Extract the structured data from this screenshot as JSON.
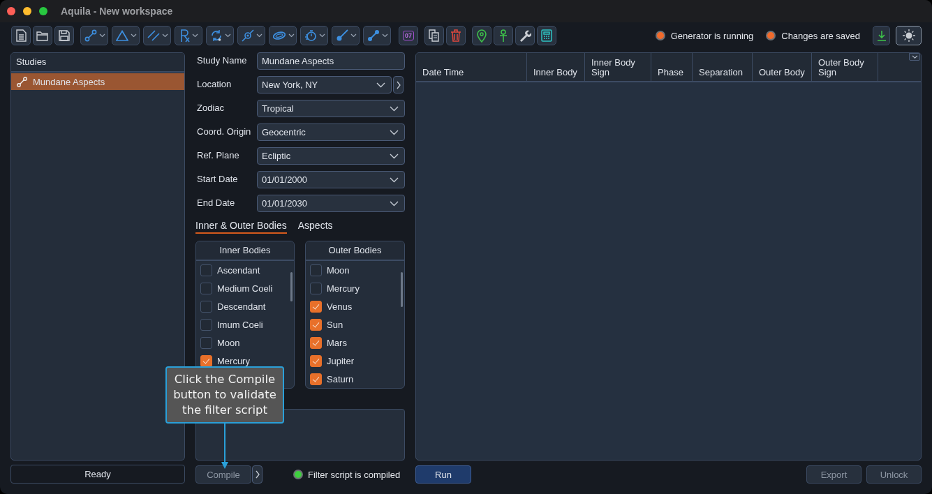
{
  "window": {
    "title": "Aquila - New workspace"
  },
  "toolbar": {
    "date_badge": "07",
    "status_lights": [
      {
        "label": "Generator is running",
        "color": "#f26b2c"
      },
      {
        "label": "Changes are saved",
        "color": "#f26b2c"
      }
    ]
  },
  "studies": {
    "title": "Studies",
    "items": [
      {
        "label": "Mundane Aspects",
        "selected": true
      }
    ],
    "status": "Ready"
  },
  "study_form": {
    "fields": [
      {
        "label": "Study Name",
        "kind": "text",
        "value": "Mundane Aspects"
      },
      {
        "label": "Location",
        "kind": "select_more",
        "value": "New York, NY"
      },
      {
        "label": "Zodiac",
        "kind": "select",
        "value": "Tropical"
      },
      {
        "label": "Coord. Origin",
        "kind": "select",
        "value": "Geocentric"
      },
      {
        "label": "Ref. Plane",
        "kind": "select",
        "value": "Ecliptic"
      },
      {
        "label": "Start Date",
        "kind": "select",
        "value": "01/01/2000"
      },
      {
        "label": "End Date",
        "kind": "select",
        "value": "01/01/2030"
      }
    ],
    "tabs": [
      {
        "label": "Inner & Outer Bodies",
        "selected": true
      },
      {
        "label": "Aspects",
        "selected": false
      }
    ],
    "body_lists": [
      {
        "title": "Inner Bodies",
        "items": [
          {
            "label": "Ascendant",
            "checked": false
          },
          {
            "label": "Medium Coeli",
            "checked": false
          },
          {
            "label": "Descendant",
            "checked": false
          },
          {
            "label": "Imum Coeli",
            "checked": false
          },
          {
            "label": "Moon",
            "checked": false
          },
          {
            "label": "Mercury",
            "checked": true
          }
        ]
      },
      {
        "title": "Outer Bodies",
        "items": [
          {
            "label": "Moon",
            "checked": false
          },
          {
            "label": "Mercury",
            "checked": false
          },
          {
            "label": "Venus",
            "checked": true
          },
          {
            "label": "Sun",
            "checked": true
          },
          {
            "label": "Mars",
            "checked": true
          },
          {
            "label": "Jupiter",
            "checked": true
          },
          {
            "label": "Saturn",
            "checked": true
          }
        ]
      }
    ],
    "compile_button": {
      "label": "Compile",
      "disabled": true
    },
    "compile_status": {
      "label": "Filter script is compiled",
      "color": "#3fcf3f"
    },
    "tooltip": "Click the Compile button to validate the filter script"
  },
  "results_table": {
    "columns": [
      "Date Time",
      "Inner Body",
      "Inner Body Sign",
      "Phase",
      "Separation",
      "Outer Body",
      "Outer Body Sign"
    ]
  },
  "run_button": {
    "label": "Run",
    "disabled": false
  },
  "table_actions": [
    {
      "label": "Export",
      "disabled": true
    },
    {
      "label": "Unlock",
      "disabled": true
    }
  ]
}
